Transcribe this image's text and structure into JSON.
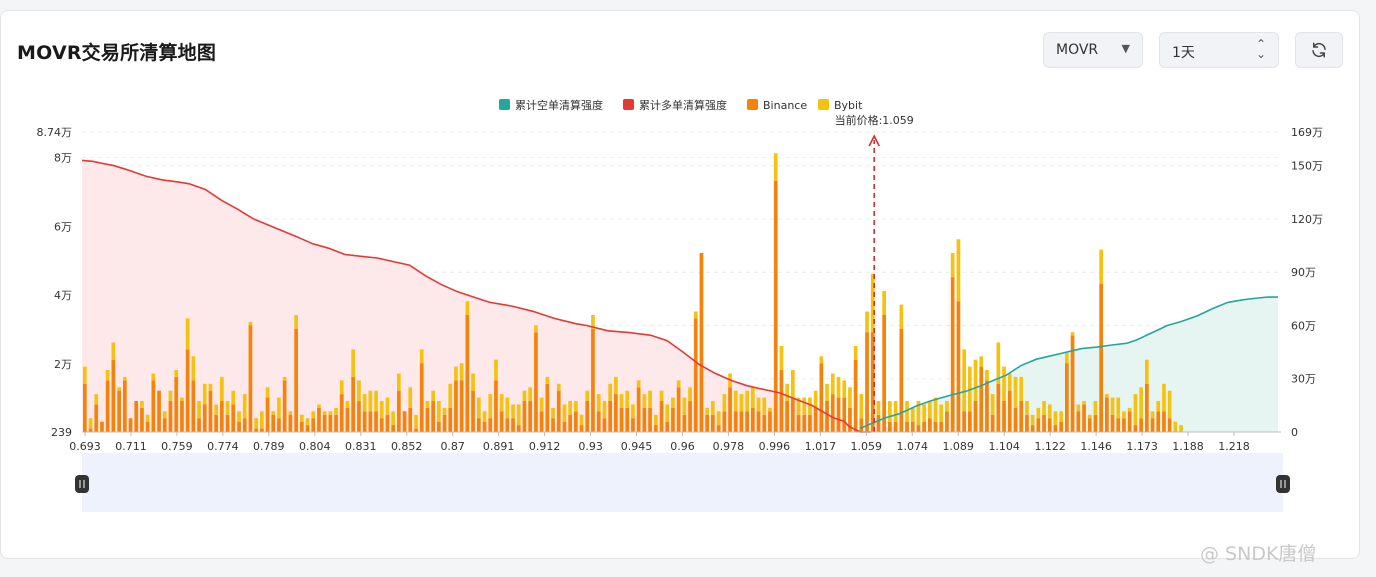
{
  "header": {
    "title": "MOVR交易所清算地图",
    "symbol_select": "MOVR",
    "range_select": "1天"
  },
  "watermark": "@ SNDK唐僧",
  "colors": {
    "short_cum": "#26a69a",
    "long_cum": "#e53935",
    "binance": "#f5820b",
    "bybit": "#f5c211",
    "long_fill": "#fde8ea",
    "short_fill": "#e6f5f2",
    "slider_fill": "#edf2fd"
  },
  "chart_data": {
    "type": "bar",
    "title": "",
    "current_price_label": "当前价格:1.059",
    "current_price": 1.059,
    "legend": [
      "累计空单清算强度",
      "累计多单清算强度",
      "Binance",
      "Bybit"
    ],
    "x_tick_labels": [
      "0.693",
      "0.711",
      "0.759",
      "0.774",
      "0.789",
      "0.804",
      "0.831",
      "0.852",
      "0.87",
      "0.891",
      "0.912",
      "0.93",
      "0.945",
      "0.96",
      "0.978",
      "0.996",
      "1.017",
      "1.059",
      "1.074",
      "1.089",
      "1.104",
      "1.122",
      "1.146",
      "1.173",
      "1.188",
      "1.218"
    ],
    "y_left": {
      "ticks": [
        {
          "v": 239,
          "label": "239"
        },
        {
          "v": 20000,
          "label": "2万"
        },
        {
          "v": 40000,
          "label": "4万"
        },
        {
          "v": 60000,
          "label": "6万"
        },
        {
          "v": 80000,
          "label": "8万"
        },
        {
          "v": 87400,
          "label": "8.74万"
        }
      ],
      "range": [
        239,
        87400
      ]
    },
    "y_right": {
      "ticks": [
        {
          "v": 0,
          "label": "0"
        },
        {
          "v": 300000,
          "label": "30万"
        },
        {
          "v": 600000,
          "label": "60万"
        },
        {
          "v": 900000,
          "label": "90万"
        },
        {
          "v": 1200000,
          "label": "120万"
        },
        {
          "v": 1500000,
          "label": "150万"
        },
        {
          "v": 1690000,
          "label": "169万"
        }
      ],
      "range": [
        0,
        1690000
      ]
    },
    "bar_count": 210,
    "current_price_index": 137,
    "binance": [
      14000,
      1000,
      8000,
      3000,
      15000,
      21000,
      12000,
      15000,
      4000,
      9000,
      7000,
      3000,
      15000,
      12000,
      4000,
      9000,
      16000,
      9000,
      24000,
      15000,
      4000,
      8000,
      12000,
      5000,
      9000,
      5000,
      8000,
      3000,
      4000,
      31000,
      1000,
      1000,
      10000,
      5000,
      4000,
      15000,
      5000,
      30000,
      3000,
      2000,
      4000,
      7000,
      5000,
      5000,
      5000,
      11000,
      7000,
      16000,
      9000,
      6000,
      6000,
      6000,
      4000,
      5000,
      2000,
      12000,
      6000,
      7000,
      1000,
      20000,
      7000,
      9000,
      3000,
      5000,
      7000,
      15000,
      15000,
      34000,
      12000,
      4000,
      3000,
      4000,
      15000,
      6000,
      4000,
      4000,
      2000,
      9000,
      9000,
      29000,
      6000,
      14000,
      4000,
      12000,
      3000,
      5000,
      6000,
      2000,
      9000,
      30000,
      6000,
      4000,
      9000,
      11000,
      7000,
      7000,
      4000,
      13000,
      7000,
      7000,
      2000,
      9000,
      3000,
      7000,
      13000,
      5000,
      9000,
      33000,
      52000,
      5000,
      5000,
      2000,
      6000,
      13000,
      6000,
      6000,
      6000,
      7000,
      6000,
      5000,
      6000,
      73000,
      18000,
      9000,
      10000,
      5000,
      5000,
      5000,
      7000,
      20000,
      9000,
      11000,
      10000,
      10000,
      7000,
      21000,
      4000,
      29000,
      29000,
      5000,
      34000,
      3000,
      3000,
      30000,
      3000,
      3000,
      2000,
      3000,
      4000,
      3000,
      3000,
      6000,
      45000,
      38000,
      6000,
      6000,
      9000,
      19000,
      15000,
      5000,
      14000,
      9000,
      12000,
      7000,
      9000,
      5000,
      2000,
      4000,
      5000,
      4000,
      2000,
      3000,
      20000,
      28000,
      6000,
      8000,
      4000,
      5000,
      43000,
      10000,
      5000,
      4000,
      4000,
      6000,
      2000,
      4000,
      14000,
      4000,
      6000,
      6000,
      4000
    ],
    "bybit": [
      5000,
      3000,
      3000,
      0,
      3000,
      5000,
      1000,
      1000,
      0,
      0,
      2000,
      2000,
      2000,
      0,
      2000,
      3000,
      2000,
      1000,
      9000,
      7000,
      5000,
      6000,
      2000,
      3000,
      7000,
      4000,
      4000,
      3000,
      7000,
      1000,
      3000,
      5000,
      3000,
      1000,
      6000,
      1000,
      1000,
      4000,
      2000,
      2000,
      2000,
      1000,
      1000,
      1000,
      2000,
      4000,
      2000,
      8000,
      6000,
      5000,
      6000,
      6000,
      5000,
      5000,
      4000,
      5000,
      0,
      6000,
      4000,
      4000,
      2000,
      3000,
      6000,
      2000,
      7000,
      4000,
      5000,
      4000,
      5000,
      6000,
      3000,
      7000,
      6000,
      5000,
      6000,
      4000,
      6000,
      3000,
      4000,
      2000,
      4000,
      2000,
      3000,
      2000,
      5000,
      4000,
      3000,
      3000,
      3000,
      4000,
      5000,
      5000,
      5000,
      5000,
      4000,
      5000,
      4000,
      2000,
      4000,
      5000,
      3000,
      3000,
      5000,
      3000,
      2000,
      5000,
      4000,
      2000,
      0,
      2000,
      4000,
      4000,
      5000,
      4000,
      6000,
      5000,
      6000,
      6000,
      4000,
      5000,
      1000,
      8000,
      7000,
      5000,
      8000,
      5000,
      5000,
      5000,
      5000,
      2000,
      5000,
      6000,
      6000,
      5000,
      6000,
      4000,
      7000,
      6000,
      17000,
      4000,
      7000,
      6000,
      6000,
      7000,
      6000,
      4000,
      7000,
      5000,
      5000,
      7000,
      5000,
      3000,
      7000,
      18000,
      18000,
      13000,
      12000,
      3000,
      3000,
      6000,
      12000,
      10000,
      5000,
      9000,
      7000,
      4000,
      3000,
      3000,
      4000,
      4000,
      4000,
      3000,
      3000,
      1000,
      2000,
      1000,
      1000,
      4000,
      10000,
      1000,
      5000,
      6000,
      2000,
      1000,
      9000,
      9000,
      7000,
      2000,
      3000,
      8000,
      8000,
      3000,
      2000
    ],
    "long_cum_points": [
      [
        0.0,
        1530000
      ],
      [
        0.01,
        1525000
      ],
      [
        0.02,
        1512000
      ],
      [
        0.03,
        1500000
      ],
      [
        0.045,
        1472000
      ],
      [
        0.06,
        1440000
      ],
      [
        0.075,
        1420000
      ],
      [
        0.09,
        1408000
      ],
      [
        0.1,
        1398000
      ],
      [
        0.115,
        1366000
      ],
      [
        0.13,
        1305000
      ],
      [
        0.145,
        1255000
      ],
      [
        0.16,
        1200000
      ],
      [
        0.18,
        1150000
      ],
      [
        0.2,
        1100000
      ],
      [
        0.215,
        1060000
      ],
      [
        0.23,
        1035000
      ],
      [
        0.245,
        1000000
      ],
      [
        0.26,
        990000
      ],
      [
        0.275,
        980000
      ],
      [
        0.29,
        960000
      ],
      [
        0.305,
        940000
      ],
      [
        0.32,
        880000
      ],
      [
        0.335,
        830000
      ],
      [
        0.35,
        790000
      ],
      [
        0.365,
        760000
      ],
      [
        0.38,
        730000
      ],
      [
        0.4,
        710000
      ],
      [
        0.42,
        680000
      ],
      [
        0.44,
        640000
      ],
      [
        0.46,
        610000
      ],
      [
        0.47,
        600000
      ],
      [
        0.49,
        570000
      ],
      [
        0.51,
        560000
      ],
      [
        0.53,
        545000
      ],
      [
        0.545,
        515000
      ],
      [
        0.56,
        450000
      ],
      [
        0.575,
        380000
      ],
      [
        0.59,
        330000
      ],
      [
        0.605,
        290000
      ],
      [
        0.62,
        260000
      ],
      [
        0.635,
        240000
      ],
      [
        0.65,
        220000
      ],
      [
        0.665,
        185000
      ],
      [
        0.68,
        150000
      ],
      [
        0.69,
        115000
      ],
      [
        0.7,
        80000
      ],
      [
        0.71,
        60000
      ],
      [
        0.715,
        30000
      ],
      [
        0.725,
        0
      ],
      [
        0.735,
        0
      ]
    ],
    "short_cum_points": [
      [
        0.725,
        20000
      ],
      [
        0.735,
        45000
      ],
      [
        0.75,
        80000
      ],
      [
        0.765,
        105000
      ],
      [
        0.78,
        145000
      ],
      [
        0.795,
        175000
      ],
      [
        0.81,
        200000
      ],
      [
        0.83,
        230000
      ],
      [
        0.845,
        260000
      ],
      [
        0.855,
        285000
      ],
      [
        0.87,
        320000
      ],
      [
        0.885,
        375000
      ],
      [
        0.9,
        410000
      ],
      [
        0.915,
        430000
      ],
      [
        0.93,
        450000
      ],
      [
        0.945,
        470000
      ],
      [
        0.96,
        478000
      ],
      [
        0.975,
        490000
      ],
      [
        0.99,
        500000
      ],
      [
        1.0,
        520000
      ],
      [
        1.015,
        560000
      ],
      [
        1.03,
        600000
      ],
      [
        1.045,
        625000
      ],
      [
        1.06,
        655000
      ],
      [
        1.075,
        695000
      ],
      [
        1.09,
        730000
      ],
      [
        1.105,
        745000
      ],
      [
        1.12,
        755000
      ],
      [
        1.13,
        760000
      ],
      [
        1.14,
        760000
      ]
    ]
  }
}
